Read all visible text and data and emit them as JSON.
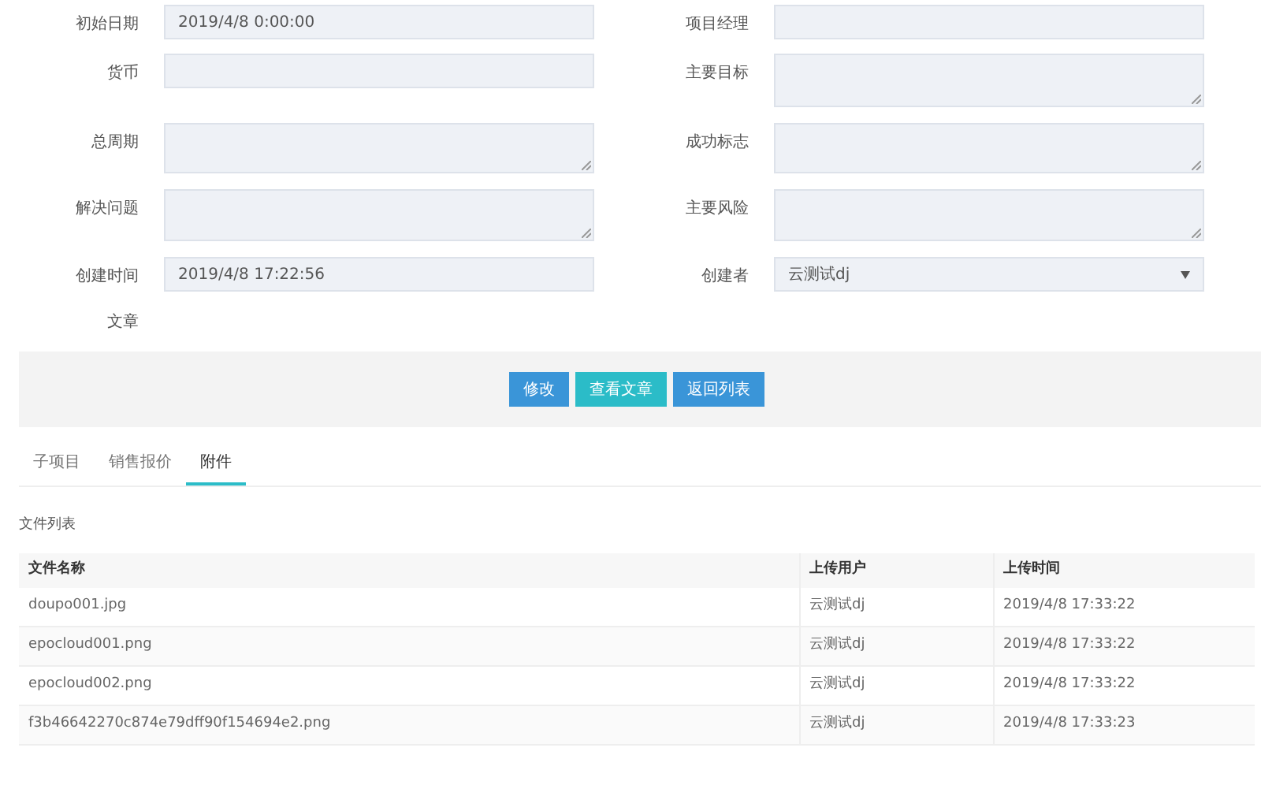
{
  "form_rows": [
    {
      "left": {
        "label": "初始日期",
        "kind": "input",
        "value": "2019/4/8 0:00:00"
      },
      "right": {
        "label": "项目经理",
        "kind": "input"
      }
    },
    {
      "left": {
        "label": "货币",
        "kind": "input"
      },
      "right": {
        "label": "主要目标",
        "kind": "textarea"
      }
    },
    {
      "left": {
        "label": "总周期",
        "kind": "textarea"
      },
      "right": {
        "label": "成功标志",
        "kind": "textarea"
      }
    },
    {
      "left": {
        "label": "解决问题",
        "kind": "textarea"
      },
      "right": {
        "label": "主要风险",
        "kind": "textarea"
      }
    },
    {
      "left": {
        "label": "创建时间",
        "kind": "input",
        "value": "2019/4/8 17:22:56"
      },
      "right": {
        "label": "创建者",
        "kind": "select",
        "value": "云测试dj"
      }
    }
  ],
  "article_label": "文章",
  "buttons": [
    {
      "label": "修改",
      "color": "#3a95d8"
    },
    {
      "label": "查看文章",
      "color": "#2bbcc8"
    },
    {
      "label": "返回列表",
      "color": "#3a95d8"
    }
  ],
  "tabs": [
    {
      "label": "子项目",
      "selected": false
    },
    {
      "label": "销售报价",
      "selected": false
    },
    {
      "label": "附件",
      "selected": true
    }
  ],
  "file_list": {
    "title": "文件列表",
    "columns": [
      "文件名称",
      "上传用户",
      "上传时间"
    ],
    "rows": [
      [
        "doupo001.jpg",
        "云测试dj",
        "2019/4/8 17:33:22"
      ],
      [
        "epocloud001.png",
        "云测试dj",
        "2019/4/8 17:33:22"
      ],
      [
        "epocloud002.png",
        "云测试dj",
        "2019/4/8 17:33:22"
      ],
      [
        "f3b46642270c874e79dff90f154694e2.png",
        "云测试dj",
        "2019/4/8 17:33:23"
      ]
    ]
  }
}
